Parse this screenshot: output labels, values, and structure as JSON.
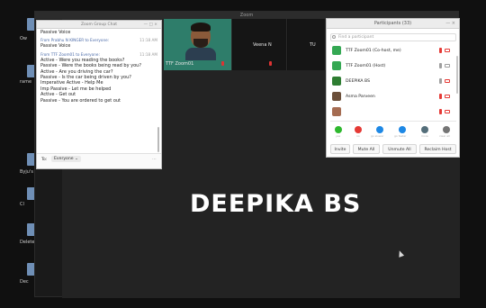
{
  "desktop": {
    "icons": [
      {
        "label": "Ow"
      },
      {
        "label": "rame"
      },
      {
        "label": "Byju's Ori"
      },
      {
        "label": "Cl"
      },
      {
        "label": "Deleted"
      },
      {
        "label": "Dec"
      }
    ]
  },
  "zoom": {
    "window_title": "Zoom",
    "stage_name": "DEEPIKA BS",
    "video_tiles": [
      {
        "name": "TTF Zoom01"
      },
      {
        "name": "Veena N"
      },
      {
        "name": "TU"
      }
    ]
  },
  "chat": {
    "title": "Zoom Group Chat",
    "messages_top": [
      "Passive Voice"
    ],
    "message_1": {
      "from": "From Prabhu N KINGER to Everyone:",
      "time": "11:18 AM",
      "lines": [
        "Passive Voice"
      ]
    },
    "message_2": {
      "from": "From TTF Zoom01 to Everyone:",
      "time": "11:18 AM",
      "lines": [
        "Active - Were you reading the books?",
        "Passive - Were the books being read by you?",
        "Active - Are you driving the car?",
        "Passive - Is the car being driven by you?",
        "Imperative Active - Help Me",
        "Imp Passive - Let me be helped",
        "Active - Get out",
        "Passive - You are ordered to get out"
      ]
    },
    "to_label": "To:",
    "to_value": "Everyone",
    "file_label": "File"
  },
  "participants": {
    "title": "Participants (33)",
    "search_placeholder": "Find a participant",
    "list": [
      {
        "name": "TTF Zoom01 (Co-host, me)",
        "avatar_color": "#34a853"
      },
      {
        "name": "TTF Zoom01 (Host)",
        "avatar_color": "#34a853"
      },
      {
        "name": "DEEPIKA BS",
        "avatar_color": "#2e7d32"
      },
      {
        "name": "Asma Parveen",
        "avatar_color": "#6b4f3a"
      },
      {
        "name": "",
        "avatar_color": "#a56c52"
      }
    ],
    "reactions": [
      {
        "label": "yes",
        "color": "#2eb82e"
      },
      {
        "label": "no",
        "color": "#e53935"
      },
      {
        "label": "go slower",
        "color": "#1e88e5"
      },
      {
        "label": "go faster",
        "color": "#1e88e5"
      },
      {
        "label": "more",
        "color": "#546e7a"
      },
      {
        "label": "clear all",
        "color": "#757575"
      }
    ],
    "buttons": {
      "invite": "Invite",
      "mute_all": "Mute All",
      "unmute_all": "Unmute All",
      "reclaim_host": "Reclaim Host"
    }
  }
}
